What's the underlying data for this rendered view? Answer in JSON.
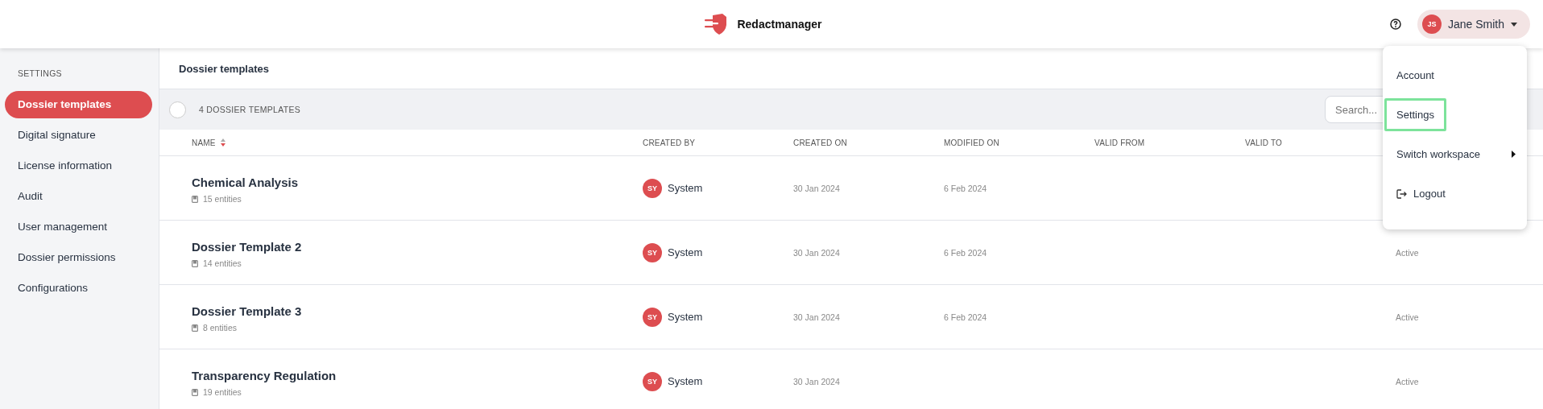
{
  "header": {
    "app_name": "Redactmanager",
    "user": {
      "initials": "JS",
      "name": "Jane Smith"
    }
  },
  "sidebar": {
    "heading": "SETTINGS",
    "items": [
      {
        "label": "Dossier templates",
        "selected": true
      },
      {
        "label": "Digital signature",
        "selected": false
      },
      {
        "label": "License information",
        "selected": false
      },
      {
        "label": "Audit",
        "selected": false
      },
      {
        "label": "User management",
        "selected": false
      },
      {
        "label": "Dossier permissions",
        "selected": false
      },
      {
        "label": "Configurations",
        "selected": false
      }
    ]
  },
  "page_title": "Dossier templates",
  "toolbar": {
    "select_all_checked": false,
    "count_label": "4 DOSSIER TEMPLATES",
    "search": {
      "placeholder": "Search..."
    }
  },
  "table": {
    "columns": [
      "NAME",
      "CREATED BY",
      "CREATED ON",
      "MODIFIED ON",
      "VALID FROM",
      "VALID TO"
    ],
    "rows": [
      {
        "name": "Chemical Analysis",
        "entities": "15 entities",
        "creator_initials": "SY",
        "created_by": "System",
        "created_on": "30 Jan 2024",
        "modified_on": "6 Feb 2024"
      },
      {
        "name": "Dossier Template 2",
        "entities": "14 entities",
        "creator_initials": "SY",
        "created_by": "System",
        "created_on": "30 Jan 2024",
        "modified_on": "6 Feb 2024",
        "status": "Active"
      },
      {
        "name": "Dossier Template 3",
        "entities": "8 entities",
        "creator_initials": "SY",
        "created_by": "System",
        "created_on": "30 Jan 2024",
        "modified_on": "6 Feb 2024",
        "status": "Active"
      },
      {
        "name": "Transparency Regulation",
        "entities": "19 entities",
        "creator_initials": "SY",
        "created_by": "System",
        "created_on": "30 Jan 2024",
        "status": "Active"
      }
    ]
  },
  "user_menu": {
    "items": [
      {
        "label": "Account",
        "kind": "plain",
        "highlighted": false
      },
      {
        "label": "Settings",
        "kind": "plain",
        "highlighted": true
      },
      {
        "label": "Switch workspace",
        "kind": "submenu",
        "highlighted": false
      },
      {
        "label": "Logout",
        "kind": "logout",
        "highlighted": false
      }
    ]
  }
}
